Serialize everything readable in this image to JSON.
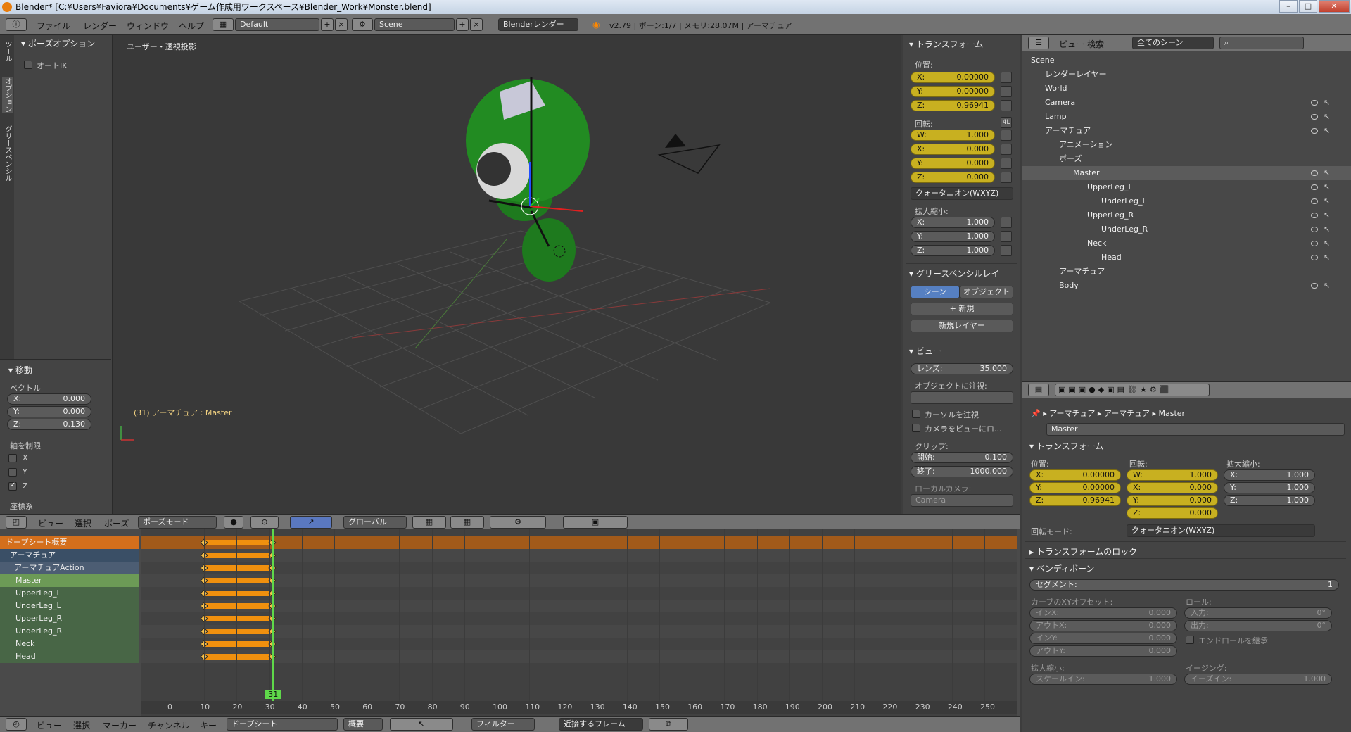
{
  "titlebar": {
    "title": "Blender* [C:¥Users¥Faviora¥Documents¥ゲーム作成用ワークスペース¥Blender_Work¥Monster.blend]",
    "minimize": "–",
    "maximize": "□",
    "close": "✕"
  },
  "topmenu": {
    "menus": [
      "ファイル",
      "レンダー",
      "ウィンドウ",
      "ヘルプ"
    ],
    "layout": "Default",
    "scene": "Scene",
    "engine": "Blenderレンダー",
    "info": "v2.79 | ボーン:1/7 | メモリ:28.07M | アーマチュア"
  },
  "toolshelf": {
    "tabs": [
      "ツール",
      "オプション",
      "グリースペンシル"
    ],
    "section": "ポーズオプション",
    "autoik": "オートIK"
  },
  "operator": {
    "title": "移動",
    "vector_label": "ベクトル",
    "x": "0.000",
    "y": "0.000",
    "z": "0.130",
    "constraint_label": "軸を制限",
    "axes": [
      "X",
      "Y",
      "Z"
    ],
    "axes_checked": [
      false,
      false,
      true
    ],
    "coords_label": "座標系"
  },
  "viewport": {
    "view_name": "ユーザー・透視投影",
    "status": "(31) アーマチュア : Master"
  },
  "npanel": {
    "transform_title": "トランスフォーム",
    "location_label": "位置:",
    "loc": [
      "0.00000",
      "0.00000",
      "0.96941"
    ],
    "rotation_label": "回転:",
    "rot_mode_btn": "4L",
    "rot": [
      "1.000",
      "0.000",
      "0.000",
      "0.000"
    ],
    "rot_mode": "クォータニオン(WXYZ)",
    "scale_label": "拡大縮小:",
    "scale": [
      "1.000",
      "1.000",
      "1.000"
    ],
    "gp_title": "グリースペンシルレイ",
    "gp_scene": "シーン",
    "gp_object": "オブジェクト",
    "gp_new": "新規",
    "gp_new_layer": "新規レイヤー",
    "view_title": "ビュー",
    "lens_label": "レンズ:",
    "lens": "35.000",
    "lock_label": "オブジェクトに注視:",
    "lock_cursor": "カーソルを注視",
    "lock_camera": "カメラをビューにロ...",
    "clip_label": "クリップ:",
    "clip_start_label": "開始:",
    "clip_start": "0.100",
    "clip_end_label": "終了:",
    "clip_end": "1000.000",
    "local_camera_label": "ローカルカメラ:",
    "local_camera": "Camera"
  },
  "labels_wxyz": [
    "W:",
    "X:",
    "Y:",
    "Z:"
  ],
  "labels_xyz": [
    "X:",
    "Y:",
    "Z:"
  ],
  "viewport_header": {
    "menus": [
      "ビュー",
      "選択",
      "ポーズ"
    ],
    "mode": "ポーズモード",
    "orientation": "グローバル"
  },
  "dopesheet": {
    "channels": [
      {
        "name": "ドープシート概要",
        "type": "summary"
      },
      {
        "name": "アーマチュア",
        "type": "object"
      },
      {
        "name": "アーマチュアAction",
        "type": "action"
      },
      {
        "name": "Master",
        "type": "group-selected"
      },
      {
        "name": "UpperLeg_L",
        "type": "group"
      },
      {
        "name": "UnderLeg_L",
        "type": "group"
      },
      {
        "name": "UpperLeg_R",
        "type": "group"
      },
      {
        "name": "UnderLeg_R",
        "type": "group"
      },
      {
        "name": "Neck",
        "type": "group"
      },
      {
        "name": "Head",
        "type": "group"
      }
    ],
    "ticks": [
      "0",
      "10",
      "20",
      "30",
      "40",
      "50",
      "60",
      "70",
      "80",
      "90",
      "100",
      "110",
      "120",
      "130",
      "140",
      "150",
      "160",
      "170",
      "180",
      "190",
      "200",
      "210",
      "220",
      "230",
      "240",
      "250"
    ],
    "current_frame": "31",
    "key_start": 10,
    "key_end": 31
  },
  "dopesheet_header": {
    "menus": [
      "ビュー",
      "選択",
      "マーカー",
      "チャンネル",
      "キー"
    ],
    "mode": "ドープシート",
    "summary": "概要",
    "filter": "フィルター",
    "snap": "近接するフレーム"
  },
  "outliner": {
    "header": {
      "menus": [
        "ビュー",
        "検索"
      ],
      "scope": "全てのシーン"
    },
    "items": [
      {
        "name": "Scene",
        "indent": 0
      },
      {
        "name": "レンダーレイヤー",
        "indent": 1
      },
      {
        "name": "World",
        "indent": 1
      },
      {
        "name": "Camera",
        "indent": 1
      },
      {
        "name": "Lamp",
        "indent": 1
      },
      {
        "name": "アーマチュア",
        "indent": 1
      },
      {
        "name": "アニメーション",
        "indent": 2
      },
      {
        "name": "ポーズ",
        "indent": 2
      },
      {
        "name": "Master",
        "indent": 3
      },
      {
        "name": "UpperLeg_L",
        "indent": 4
      },
      {
        "name": "UnderLeg_L",
        "indent": 5
      },
      {
        "name": "UpperLeg_R",
        "indent": 4
      },
      {
        "name": "UnderLeg_R",
        "indent": 5
      },
      {
        "name": "Neck",
        "indent": 4
      },
      {
        "name": "Head",
        "indent": 5
      },
      {
        "name": "アーマチュア",
        "indent": 2
      },
      {
        "name": "Body",
        "indent": 2
      }
    ]
  },
  "properties": {
    "breadcrumb": [
      "アーマチュア",
      "アーマチュア",
      "Master"
    ],
    "bone_name": "Master",
    "transform_title": "トランスフォーム",
    "loc_label": "位置:",
    "loc": [
      "0.00000",
      "0.00000",
      "0.96941"
    ],
    "rot_label": "回転:",
    "rot": [
      "1.000",
      "0.000",
      "0.000",
      "0.000"
    ],
    "scale_label": "拡大縮小:",
    "scale": [
      "1.000",
      "1.000",
      "1.000"
    ],
    "rot_mode_label": "回転モード:",
    "rot_mode": "クォータニオン(WXYZ)",
    "lock_title": "トランスフォームのロック",
    "bendy_title": "ベンディボーン",
    "segments_label": "セグメント:",
    "segments": "1",
    "curve_label": "カーブのXYオフセット:",
    "roll_label": "ロール:",
    "in_x_label": "インX:",
    "in_x": "0.000",
    "out_x_label": "アウトX:",
    "out_x": "0.000",
    "in_y_label": "インY:",
    "in_y": "0.000",
    "out_y_label": "アウトY:",
    "out_y": "0.000",
    "roll_in_label": "入力:",
    "roll_in": "0°",
    "roll_out_label": "出力:",
    "roll_out": "0°",
    "inherit_roll": "エンドロールを継承",
    "scale_section": "拡大縮小:",
    "easing_label": "イージング:",
    "scale_in_label": "スケールイン:",
    "scale_in": "1.000",
    "ease_in_label": "イーズイン:",
    "ease_in": "1.000"
  }
}
